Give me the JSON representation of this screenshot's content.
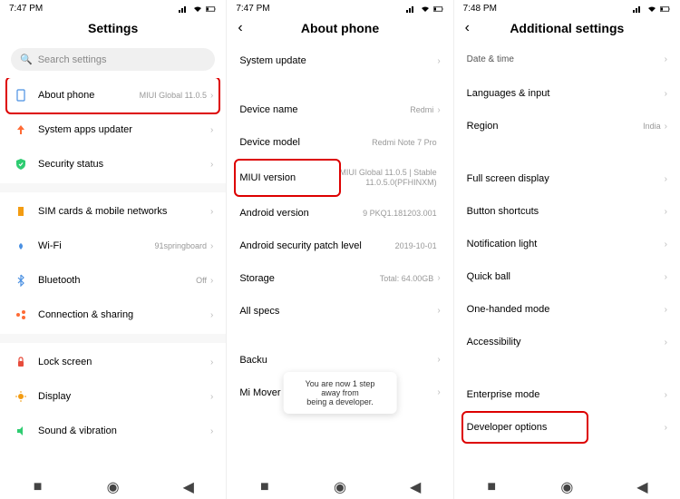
{
  "screen1": {
    "time": "7:47 PM",
    "title": "Settings",
    "search_placeholder": "Search settings",
    "rows": {
      "about": {
        "label": "About phone",
        "value": "MIUI Global 11.0.5"
      },
      "updater": {
        "label": "System apps updater"
      },
      "security": {
        "label": "Security status"
      },
      "sim": {
        "label": "SIM cards & mobile networks"
      },
      "wifi": {
        "label": "Wi-Fi",
        "value": "91springboard"
      },
      "bt": {
        "label": "Bluetooth",
        "value": "Off"
      },
      "conn": {
        "label": "Connection & sharing"
      },
      "lock": {
        "label": "Lock screen"
      },
      "display": {
        "label": "Display"
      },
      "sound": {
        "label": "Sound & vibration"
      }
    }
  },
  "screen2": {
    "time": "7:47 PM",
    "title": "About phone",
    "rows": {
      "sysupdate": {
        "label": "System update"
      },
      "devname": {
        "label": "Device name",
        "value": "Redmi"
      },
      "devmodel": {
        "label": "Device model",
        "value": "Redmi Note 7 Pro"
      },
      "miui": {
        "label": "MIUI version",
        "value": "MIUI Global 11.0.5 | Stable\n11.0.5.0(PFHINXM)"
      },
      "android": {
        "label": "Android version",
        "value": "9 PKQ1.181203.001"
      },
      "patch": {
        "label": "Android security patch level",
        "value": "2019-10-01"
      },
      "storage": {
        "label": "Storage",
        "value": "Total: 64.00GB"
      },
      "allspecs": {
        "label": "All specs"
      },
      "backup": {
        "label": "Backu"
      },
      "mover": {
        "label": "Mi Mover"
      }
    },
    "toast": "You are now 1 step away from\nbeing a developer."
  },
  "screen3": {
    "time": "7:48 PM",
    "title": "Additional settings",
    "rows": {
      "datetime": {
        "label": "Date & time"
      },
      "lang": {
        "label": "Languages & input"
      },
      "region": {
        "label": "Region",
        "value": "India"
      },
      "fullscreen": {
        "label": "Full screen display"
      },
      "btnshort": {
        "label": "Button shortcuts"
      },
      "notiflight": {
        "label": "Notification light"
      },
      "quickball": {
        "label": "Quick ball"
      },
      "onehand": {
        "label": "One-handed mode"
      },
      "access": {
        "label": "Accessibility"
      },
      "enterprise": {
        "label": "Enterprise mode"
      },
      "devopts": {
        "label": "Developer options"
      }
    }
  }
}
